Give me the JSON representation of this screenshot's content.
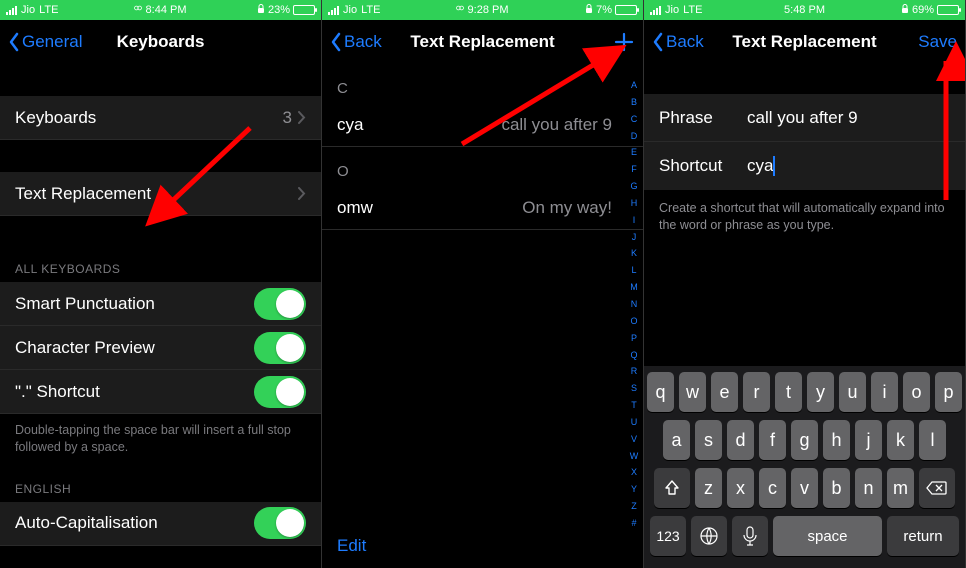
{
  "screen1": {
    "status": {
      "carrier": "Jio",
      "net": "LTE",
      "time": "8:44 PM",
      "battery_pct": "23%",
      "battery_fill": 23,
      "hotspot_icon": true
    },
    "nav": {
      "back": "General",
      "title": "Keyboards"
    },
    "rows": {
      "keyboards_label": "Keyboards",
      "keyboards_count": "3",
      "text_replacement": "Text Replacement"
    },
    "all_kb_header": "ALL KEYBOARDS",
    "toggles": {
      "smart_punct": "Smart Punctuation",
      "char_preview": "Character Preview",
      "dot_shortcut": "\".\" Shortcut"
    },
    "footer": "Double-tapping the space bar will insert a full stop followed by a space.",
    "english_header": "ENGLISH",
    "auto_cap": "Auto-Capitalisation"
  },
  "screen2": {
    "status": {
      "carrier": "Jio",
      "net": "LTE",
      "time": "9:28 PM",
      "battery_pct": "7%",
      "battery_fill": 7,
      "hotspot_icon": true
    },
    "nav": {
      "back": "Back",
      "title": "Text Replacement"
    },
    "sections": [
      {
        "letter": "C",
        "items": [
          {
            "short": "cya",
            "phrase": "call you after 9"
          }
        ]
      },
      {
        "letter": "O",
        "items": [
          {
            "short": "omw",
            "phrase": "On my way!"
          }
        ]
      }
    ],
    "edit": "Edit",
    "index": [
      "A",
      "B",
      "C",
      "D",
      "E",
      "F",
      "G",
      "H",
      "I",
      "J",
      "K",
      "L",
      "M",
      "N",
      "O",
      "P",
      "Q",
      "R",
      "S",
      "T",
      "U",
      "V",
      "W",
      "X",
      "Y",
      "Z",
      "#"
    ]
  },
  "screen3": {
    "status": {
      "carrier": "Jio",
      "net": "LTE",
      "time": "5:48 PM",
      "battery_pct": "69%",
      "battery_fill": 69
    },
    "nav": {
      "back": "Back",
      "title": "Text Replacement",
      "save": "Save"
    },
    "form": {
      "phrase_label": "Phrase",
      "phrase_value": "call you after 9",
      "shortcut_label": "Shortcut",
      "shortcut_value": "cya"
    },
    "note": "Create a shortcut that will automatically expand into the word or phrase as you type.",
    "keyboard": {
      "row1": [
        "q",
        "w",
        "e",
        "r",
        "t",
        "y",
        "u",
        "i",
        "o",
        "p"
      ],
      "row2": [
        "a",
        "s",
        "d",
        "f",
        "g",
        "h",
        "j",
        "k",
        "l"
      ],
      "row3": [
        "z",
        "x",
        "c",
        "v",
        "b",
        "n",
        "m"
      ],
      "num": "123",
      "space": "space",
      "return": "return"
    }
  }
}
